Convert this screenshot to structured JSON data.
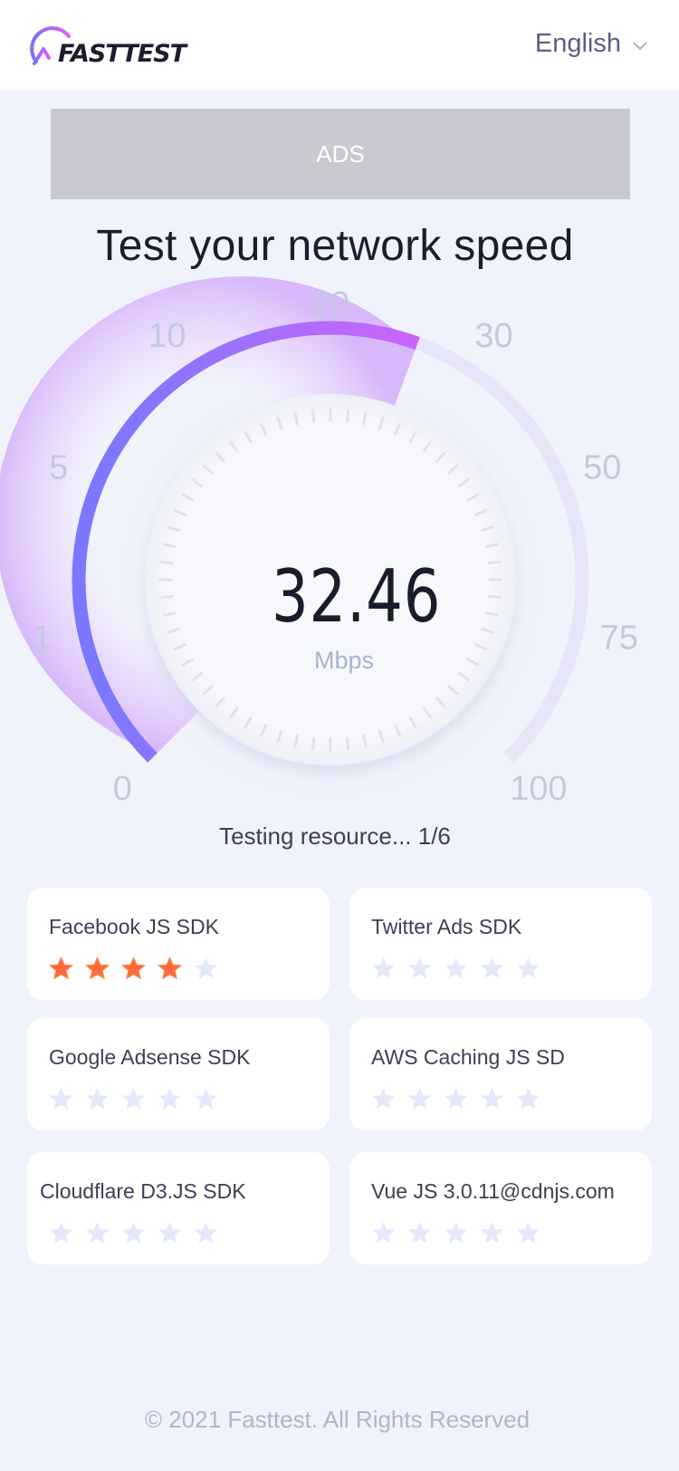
{
  "header": {
    "logo_text": "FASTTEST",
    "language": "English"
  },
  "ads": {
    "label": "ADS"
  },
  "headline": "Test your network speed",
  "gauge": {
    "speed": "32.46",
    "unit": "Mbps",
    "scale_labels": [
      "0",
      "1",
      "5",
      "10",
      "20",
      "30",
      "50",
      "75",
      "100"
    ],
    "needle_at_label": "20"
  },
  "status": "Testing resource... 1/6",
  "resources": [
    {
      "name": "Facebook JS SDK",
      "rating": 4,
      "max": 5
    },
    {
      "name": "Twitter Ads SDK",
      "rating": 0,
      "max": 5
    },
    {
      "name": "Google Adsense SDK",
      "rating": 0,
      "max": 5
    },
    {
      "name": "AWS Caching JS SD",
      "rating": 0,
      "max": 5
    },
    {
      "name": "Cloudflare D3.JS SDK",
      "rating": 0,
      "max": 5
    },
    {
      "name": "Vue JS 3.0.11@cdnjs.com",
      "rating": 0,
      "max": 5
    }
  ],
  "footer": "© 2021 Fasttest. All Rights Reserved",
  "colors": {
    "accent_start": "#7b73ff",
    "accent_end": "#de5cf8",
    "star_active": "#ff6a3c",
    "star_inactive": "#e4e8fb"
  }
}
